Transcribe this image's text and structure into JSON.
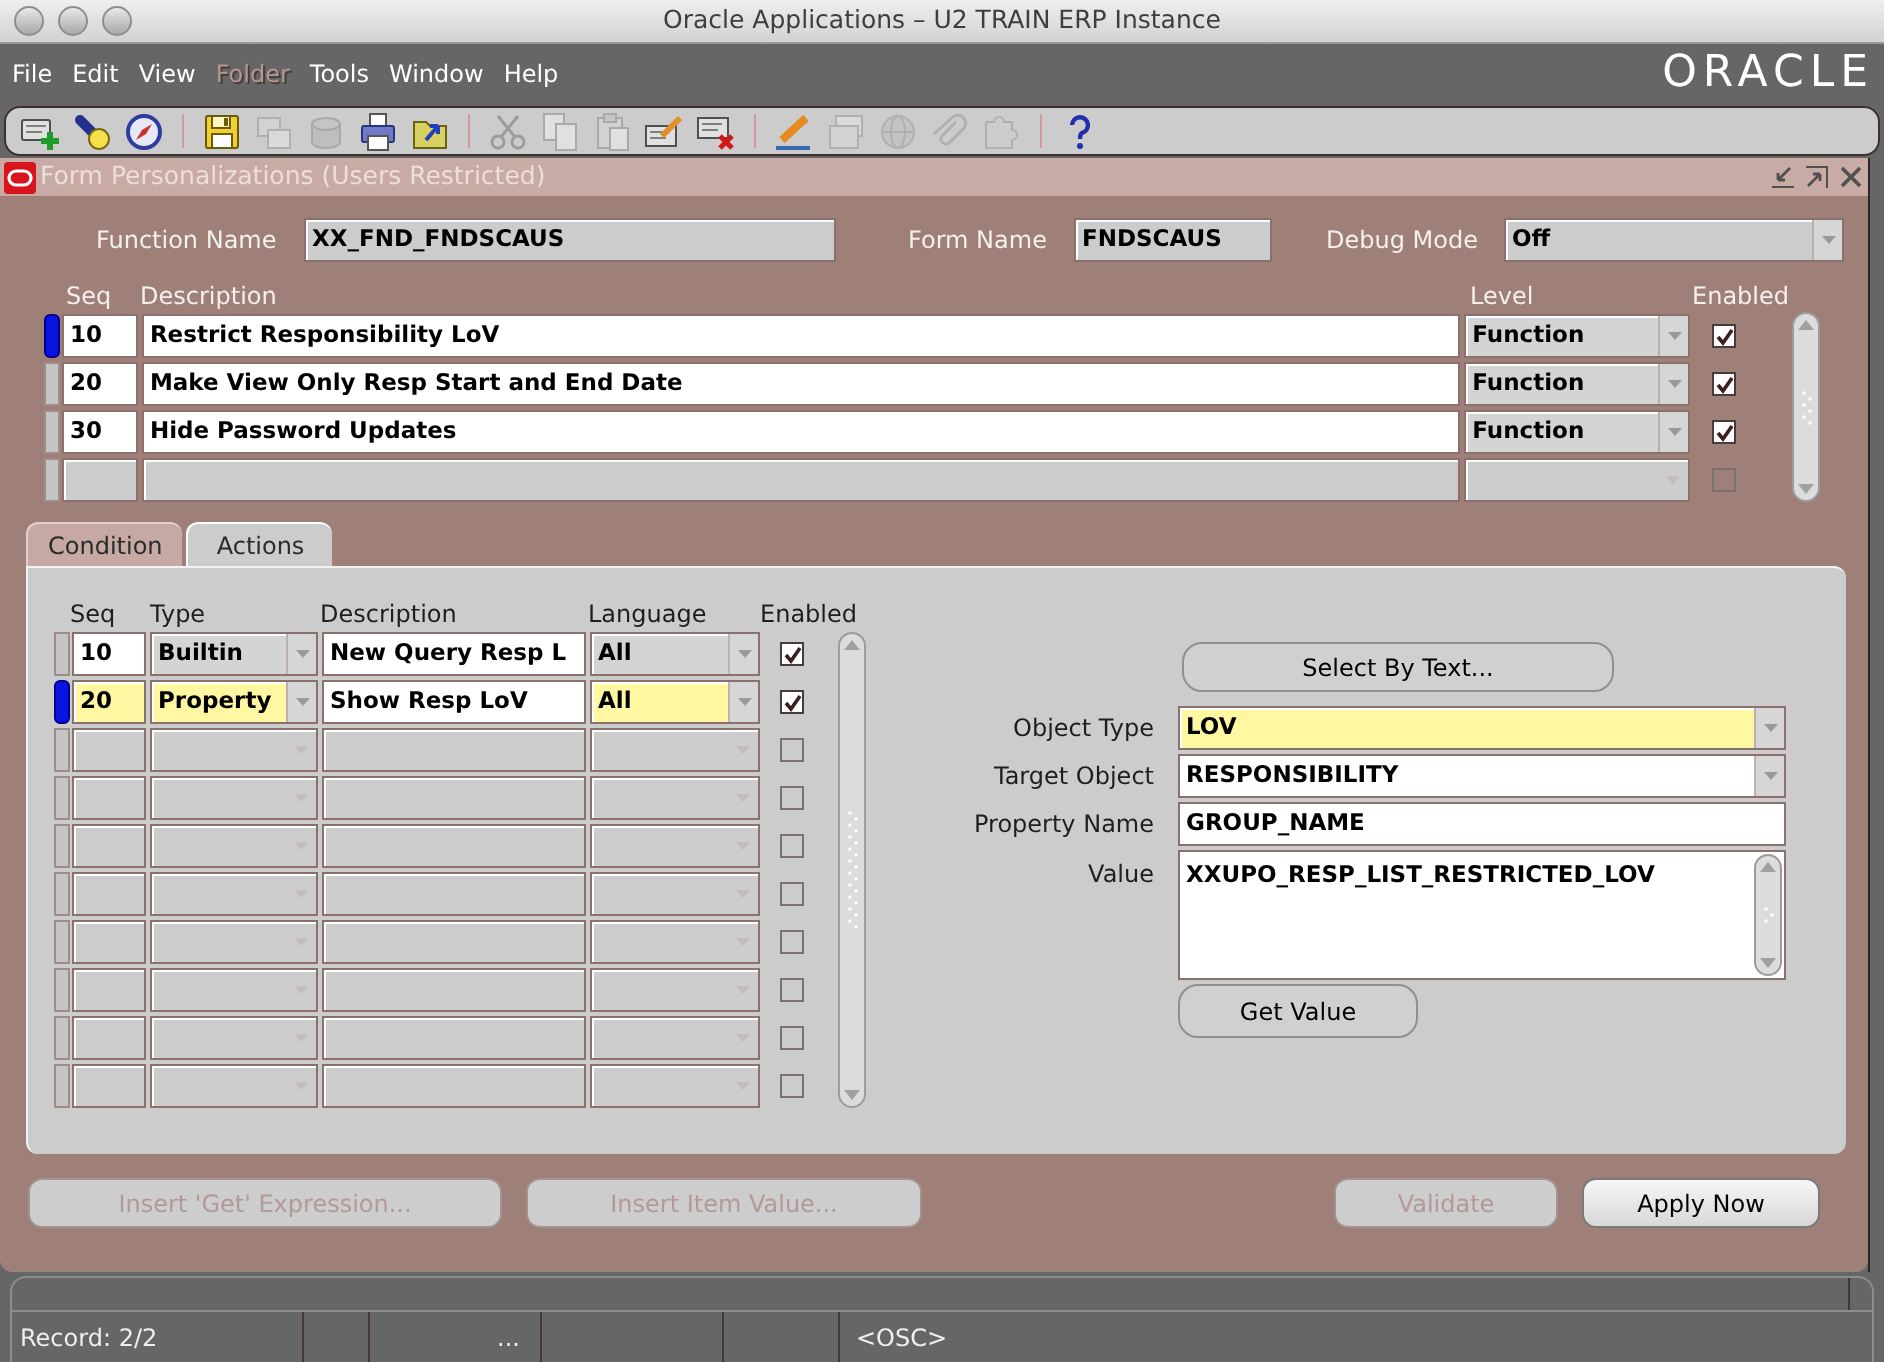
{
  "window": {
    "title": "Oracle Applications – U2 TRAIN ERP Instance"
  },
  "menu": [
    {
      "label": "File",
      "disabled": false
    },
    {
      "label": "Edit",
      "disabled": false
    },
    {
      "label": "View",
      "disabled": false
    },
    {
      "label": "Folder",
      "disabled": true
    },
    {
      "label": "Tools",
      "disabled": false
    },
    {
      "label": "Window",
      "disabled": false
    },
    {
      "label": "Help",
      "disabled": false
    }
  ],
  "logo": {
    "text": "ORACLE"
  },
  "toolbar": {
    "groups": [
      [
        {
          "disabled": false
        },
        {
          "disabled": false
        },
        {
          "disabled": false
        }
      ],
      [
        {
          "disabled": false
        },
        {
          "disabled": true
        },
        {
          "disabled": true
        },
        {
          "disabled": false
        },
        {
          "disabled": false
        }
      ],
      [
        {
          "disabled": true
        },
        {
          "disabled": true
        },
        {
          "disabled": true
        },
        {
          "disabled": false
        },
        {
          "disabled": false
        }
      ],
      [
        {
          "disabled": false
        },
        {
          "disabled": true
        },
        {
          "disabled": true
        },
        {
          "disabled": true
        },
        {
          "disabled": true
        }
      ],
      [
        {
          "disabled": false
        }
      ]
    ]
  },
  "form_window": {
    "title": "Form Personalizations (Users Restricted)"
  },
  "header_fields": [
    {
      "label": "Function Name",
      "value": "XX_FND_FNDSCAUS",
      "kind": "text"
    },
    {
      "label": "Form Name",
      "value": "FNDSCAUS",
      "kind": "text"
    },
    {
      "label": "Debug Mode",
      "value": "Off",
      "kind": "dropdown"
    }
  ],
  "rules": {
    "columns": [
      "Seq",
      "Description",
      "Level",
      "Enabled"
    ],
    "rows": [
      {
        "seq": "10",
        "description": "Restrict Responsibility LoV",
        "level": "Function",
        "enabled": true,
        "selected": true
      },
      {
        "seq": "20",
        "description": "Make View Only Resp Start and End Date",
        "level": "Function",
        "enabled": true,
        "selected": false
      },
      {
        "seq": "30",
        "description": "Hide Password Updates",
        "level": "Function",
        "enabled": true,
        "selected": false
      },
      {
        "enabled": false,
        "selected": false
      }
    ]
  },
  "tabs": [
    {
      "label": "Condition",
      "selected": false
    },
    {
      "label": "Actions",
      "selected": true
    }
  ],
  "actions": {
    "columns": [
      "Seq",
      "Type",
      "Description",
      "Language",
      "Enabled"
    ],
    "rows": [
      {
        "seq": "10",
        "type": "Builtin",
        "description": "New Query Resp L",
        "language": "All",
        "enabled": true,
        "selected": false
      },
      {
        "seq": "20",
        "type": "Property",
        "description": "Show Resp LoV",
        "language": "All",
        "enabled": true,
        "selected": true
      },
      {
        "enabled": false,
        "selected": false
      },
      {
        "enabled": false,
        "selected": false
      },
      {
        "enabled": false,
        "selected": false
      },
      {
        "enabled": false,
        "selected": false
      },
      {
        "enabled": false,
        "selected": false
      },
      {
        "enabled": false,
        "selected": false
      },
      {
        "enabled": false,
        "selected": false
      },
      {
        "enabled": false,
        "selected": false
      }
    ]
  },
  "select_by_text_button": "Select By Text...",
  "properties": [
    {
      "label": "Object Type",
      "value": "LOV",
      "kind": "dropdown",
      "required": true
    },
    {
      "label": "Target Object",
      "value": "RESPONSIBILITY",
      "kind": "dropdown",
      "required": false
    },
    {
      "label": "Property Name",
      "value": "GROUP_NAME",
      "kind": "text",
      "required": false
    },
    {
      "label": "Value",
      "value": "XXUPO_RESP_LIST_RESTRICTED_LOV",
      "kind": "textarea",
      "required": false
    }
  ],
  "get_value_button": "Get Value",
  "buttons": {
    "left": [
      {
        "label": "Insert 'Get' Expression...",
        "disabled": true
      },
      {
        "label": "Insert Item Value...",
        "disabled": true
      }
    ],
    "right": [
      {
        "label": "Validate",
        "disabled": true
      },
      {
        "label": "Apply Now",
        "disabled": false
      }
    ]
  },
  "status_bar": {
    "record": "Record: 2/2",
    "segment_3": "...",
    "segment_6": "<OSC>"
  }
}
